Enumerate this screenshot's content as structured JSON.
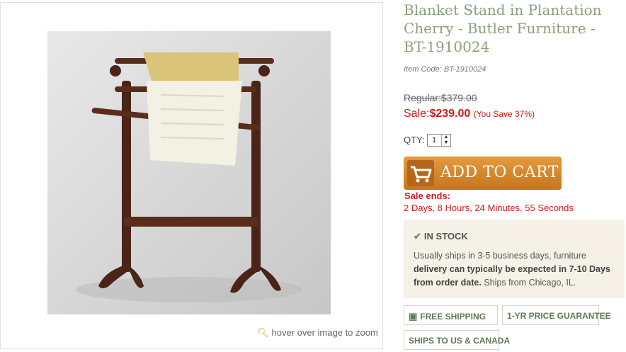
{
  "product": {
    "title": "Blanket Stand in Plantation Cherry - Butler Furniture - BT-1910024",
    "item_code": "Item Code: BT-1910024",
    "zoom_hint": "hover over image to zoom"
  },
  "pricing": {
    "regular": "Regular:$379.00",
    "sale_label": "Sale:",
    "sale_price": "$239.00",
    "you_save": "(You Save 37%)"
  },
  "quantity": {
    "label": "QTY:",
    "value": "1"
  },
  "cart": {
    "button_label": "ADD TO CART"
  },
  "sale_ends": {
    "label": "Sale ends:",
    "countdown": "2 Days, 8 Hours, 24 Minutes, 55 Seconds"
  },
  "stock": {
    "status": "IN STOCK",
    "text_1": "Usually ships in 3-5 business days, furniture ",
    "bold_1": "delivery can typically be expected in 7-10 Days from order date.",
    "text_2": " Ships from Chicago, IL."
  },
  "badges": {
    "free_shipping": "FREE SHIPPING",
    "price_guarantee": "1-YR PRICE GUARANTEE",
    "ships_to": "SHIPS TO US & CANADA"
  },
  "colors": {
    "title": "#8aa07a",
    "sale_red": "#cc1b1b",
    "cart_orange": "#d98a2f",
    "stock_bg": "#f5f1e6"
  }
}
